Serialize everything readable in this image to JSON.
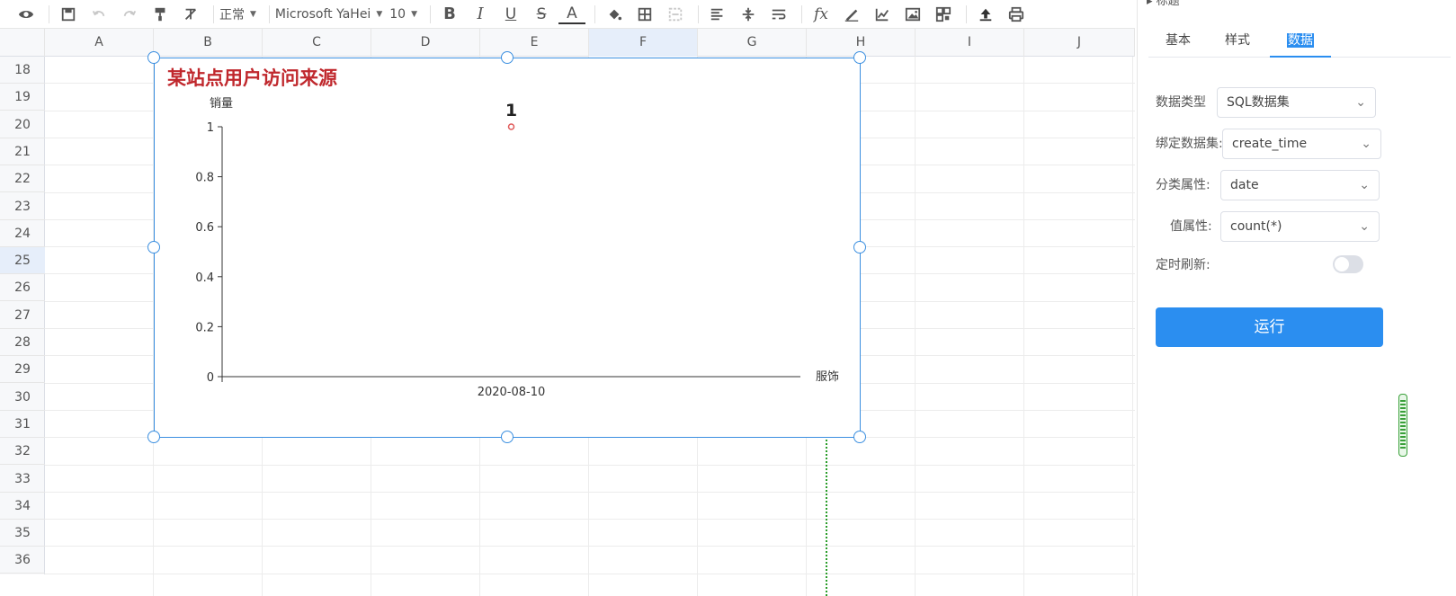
{
  "toolbar": {
    "font_style": "正常",
    "font_family": "Microsoft YaHei",
    "font_size": "10",
    "icons": [
      "eye-icon",
      "save-icon",
      "undo-icon",
      "redo-icon",
      "format-painter-icon",
      "clear-format-icon",
      "bold-icon",
      "italic-icon",
      "underline-icon",
      "strikethrough-icon",
      "font-color-icon",
      "fill-color-icon",
      "border-icon",
      "merge-cells-icon",
      "align-icon",
      "valign-icon",
      "wrap-icon",
      "function-icon",
      "edit-chart-icon",
      "chart-icon",
      "image-icon",
      "qrcode-icon",
      "upload-icon",
      "print-icon"
    ]
  },
  "grid": {
    "columns": [
      "A",
      "B",
      "C",
      "D",
      "E",
      "F",
      "G",
      "H",
      "I",
      "J"
    ],
    "active_column": "F",
    "rows": [
      "18",
      "19",
      "20",
      "21",
      "22",
      "23",
      "24",
      "25",
      "26",
      "27",
      "28",
      "29",
      "30",
      "31",
      "32",
      "33",
      "34",
      "35",
      "36"
    ],
    "active_row": "25"
  },
  "chart": {
    "title": "某站点用户访问来源",
    "chart_data": {
      "type": "scatter",
      "title": "某站点用户访问来源",
      "ylabel": "销量",
      "xlabel": "服饰",
      "categories": [
        "2020-08-10"
      ],
      "values": [
        1
      ],
      "data_labels": [
        "1"
      ],
      "ylim": [
        0,
        1
      ],
      "yticks": [
        "0",
        "0.2",
        "0.4",
        "0.6",
        "0.8",
        "1"
      ],
      "grid": false,
      "point_color": "#e05b5b"
    }
  },
  "panel": {
    "top_label": "标题",
    "tabs": [
      {
        "label": "基本"
      },
      {
        "label": "样式"
      },
      {
        "label": "数据"
      }
    ],
    "active_tab": "数据",
    "fields": {
      "data_type": {
        "label": "数据类型",
        "value": "SQL数据集"
      },
      "dataset": {
        "label": "绑定数据集:",
        "value": "create_time"
      },
      "category": {
        "label": "分类属性:",
        "value": "date"
      },
      "value": {
        "label": "值属性:",
        "value": "count(*)"
      },
      "refresh": {
        "label": "定时刷新:",
        "enabled": false
      }
    },
    "run_label": "运行",
    "accent_color": "#2b8ef0"
  }
}
